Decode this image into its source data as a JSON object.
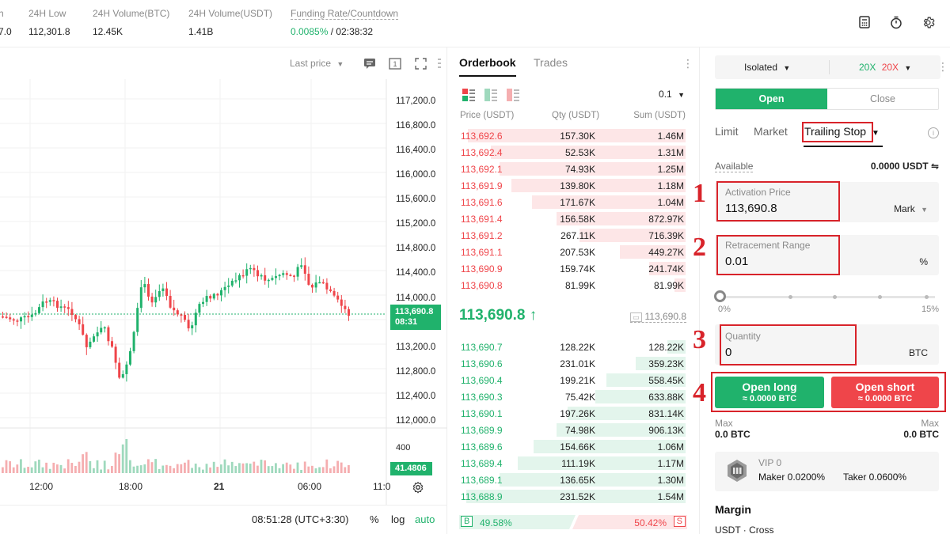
{
  "ticker": {
    "partial_left_label": "h",
    "partial_left_value": "7.0",
    "low_label": "24H Low",
    "low_value": "112,301.8",
    "vol_btc_label": "24H Volume(BTC)",
    "vol_btc_value": "12.45K",
    "vol_usdt_label": "24H Volume(USDT)",
    "vol_usdt_value": "1.41B",
    "funding_label": "Funding Rate/Countdown",
    "funding_rate": "0.0085%",
    "countdown": "/ 02:38:32",
    "icons": [
      "calculator-icon",
      "timer-icon",
      "settings-icon"
    ]
  },
  "chart": {
    "price_type": "Last price",
    "price_labels": [
      "117,200.0",
      "116,800.0",
      "116,400.0",
      "116,000.0",
      "115,600.0",
      "115,200.0",
      "114,800.0",
      "114,400.0",
      "114,000.0",
      "113,200.0",
      "112,800.0",
      "112,400.0",
      "112,000.0"
    ],
    "current_price": "113,690.8",
    "current_countdown": "08:31",
    "volume_tick": "400",
    "volume_current": "41.4806",
    "time_labels": [
      "12:00",
      "18:00",
      "21",
      "06:00",
      "11:0"
    ],
    "clock": "08:51:28 (UTC+3:30)",
    "footer_buttons": [
      "%",
      "log",
      "auto"
    ],
    "colors": {
      "up": "#20b26c",
      "down": "#ef454a"
    }
  },
  "chart_data": {
    "type": "candlestick",
    "title": "",
    "ylabel": "",
    "ylim": [
      112000,
      117200
    ],
    "x_ticks": [
      "12:00",
      "18:00",
      "21",
      "06:00",
      "11:0"
    ],
    "last_price": 113690.8,
    "note_series_visible": true
  },
  "orderbook": {
    "tab_orderbook": "Orderbook",
    "tab_trades": "Trades",
    "tick_size": "0.1",
    "col_price": "Price (USDT)",
    "col_qty": "Qty (USDT)",
    "col_sum": "Sum (USDT)",
    "asks": [
      {
        "price": "113,692.6",
        "qty": "157.30K",
        "sum": "1.46M",
        "depth": 0.96
      },
      {
        "price": "113,692.4",
        "qty": "52.53K",
        "sum": "1.31M",
        "depth": 0.86
      },
      {
        "price": "113,692.1",
        "qty": "74.93K",
        "sum": "1.25M",
        "depth": 0.82
      },
      {
        "price": "113,691.9",
        "qty": "139.80K",
        "sum": "1.18M",
        "depth": 0.77
      },
      {
        "price": "113,691.6",
        "qty": "171.67K",
        "sum": "1.04M",
        "depth": 0.68
      },
      {
        "price": "113,691.4",
        "qty": "156.58K",
        "sum": "872.97K",
        "depth": 0.57
      },
      {
        "price": "113,691.2",
        "qty": "267.11K",
        "sum": "716.39K",
        "depth": 0.47
      },
      {
        "price": "113,691.1",
        "qty": "207.53K",
        "sum": "449.27K",
        "depth": 0.29
      },
      {
        "price": "113,690.9",
        "qty": "159.74K",
        "sum": "241.74K",
        "depth": 0.16
      },
      {
        "price": "113,690.8",
        "qty": "81.99K",
        "sum": "81.99K",
        "depth": 0.05
      }
    ],
    "mid_price": "113,690.8 ↑",
    "mark_price": "113,690.8",
    "bids": [
      {
        "price": "113,690.7",
        "qty": "128.22K",
        "sum": "128.22K",
        "depth": 0.08
      },
      {
        "price": "113,690.6",
        "qty": "231.01K",
        "sum": "359.23K",
        "depth": 0.22
      },
      {
        "price": "113,690.4",
        "qty": "199.21K",
        "sum": "558.45K",
        "depth": 0.35
      },
      {
        "price": "113,690.3",
        "qty": "75.42K",
        "sum": "633.88K",
        "depth": 0.4
      },
      {
        "price": "113,690.1",
        "qty": "197.26K",
        "sum": "831.14K",
        "depth": 0.52
      },
      {
        "price": "113,689.9",
        "qty": "74.98K",
        "sum": "906.13K",
        "depth": 0.57
      },
      {
        "price": "113,689.6",
        "qty": "154.66K",
        "sum": "1.06M",
        "depth": 0.67
      },
      {
        "price": "113,689.4",
        "qty": "111.19K",
        "sum": "1.17M",
        "depth": 0.74
      },
      {
        "price": "113,689.1",
        "qty": "136.65K",
        "sum": "1.30M",
        "depth": 0.82
      },
      {
        "price": "113,688.9",
        "qty": "231.52K",
        "sum": "1.54M",
        "depth": 0.97
      }
    ],
    "buy_tag": "B",
    "buy_ratio": "49.58%",
    "sell_ratio": "50.42%",
    "sell_tag": "S",
    "buy_ratio_value": 0.4958
  },
  "trade": {
    "margin_mode": "Isolated",
    "leverage_long": "20X",
    "leverage_short": "20X",
    "open_label": "Open",
    "close_label": "Close",
    "order_types": {
      "limit": "Limit",
      "market": "Market",
      "trailing": "Trailing Stop"
    },
    "available_label": "Available",
    "available_value": "0.0000 USDT ⇋",
    "steps": [
      "1",
      "2",
      "3",
      "4"
    ],
    "activation_label": "Activation Price",
    "activation_value": "113,690.8",
    "activation_ref": "Mark",
    "retracement_label": "Retracement Range",
    "retracement_value": "0.01",
    "retracement_unit": "%",
    "slider_min": "0%",
    "slider_max": "15%",
    "slider_level": 0,
    "quantity_label": "Quantity",
    "quantity_value": "0",
    "quantity_unit": "BTC",
    "open_long_label": "Open long",
    "open_long_sub": "≈ 0.0000 BTC",
    "open_short_label": "Open short",
    "open_short_sub": "≈ 0.0000 BTC",
    "max_label": "Max",
    "max_long": "0.0 BTC",
    "max_short": "0.0 BTC",
    "vip_level": "VIP 0",
    "maker_fee": "Maker 0.0200%",
    "taker_fee": "Taker 0.0600%",
    "margin_title": "Margin",
    "margin_sub": "USDT · Cross"
  }
}
